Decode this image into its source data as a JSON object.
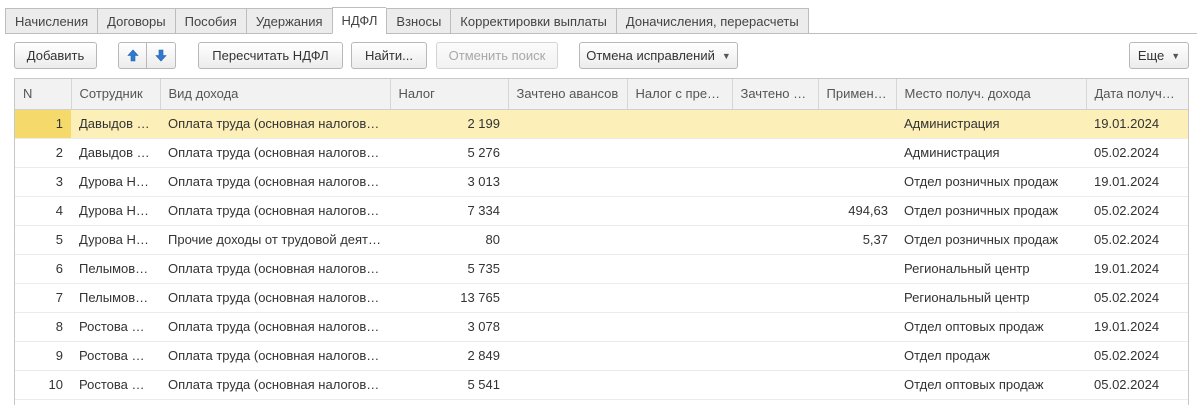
{
  "tabs": [
    {
      "label": "Начисления"
    },
    {
      "label": "Договоры"
    },
    {
      "label": "Пособия"
    },
    {
      "label": "Удержания"
    },
    {
      "label": "НДФЛ"
    },
    {
      "label": "Взносы"
    },
    {
      "label": "Корректировки выплаты"
    },
    {
      "label": "Доначисления, перерасчеты"
    }
  ],
  "active_tab": "НДФЛ",
  "toolbar": {
    "add_label": "Добавить",
    "move_up_icon": "arrow-up-icon",
    "move_down_icon": "arrow-down-icon",
    "recalc_label": "Пересчитать НДФЛ",
    "find_label": "Найти...",
    "cancel_search_label": "Отменить поиск",
    "corrections_label": "Отмена исправлений",
    "more_label": "Еще"
  },
  "colors": {
    "selected_row": "#fcefb8",
    "focused_cell": "#f5d96b",
    "arrow_icon": "#2f7ad1"
  },
  "table": {
    "columns": [
      "N",
      "Сотрудник",
      "Вид дохода",
      "Налог",
      "Зачтено авансов",
      "Налог с пре…",
      "Зачтено …",
      "Примен…",
      "Место получ. дохода",
      "Дата получения"
    ],
    "rows": [
      {
        "n": "1",
        "employee": "Давыдов …",
        "income": "Оплата труда (основная налогов…",
        "tax": "2 199",
        "advances": "",
        "tax_prem": "",
        "credited": "",
        "applied": "",
        "place": "Администрация",
        "date": "19.01.2024",
        "selected": true
      },
      {
        "n": "2",
        "employee": "Давыдов …",
        "income": "Оплата труда (основная налогов…",
        "tax": "5 276",
        "advances": "",
        "tax_prem": "",
        "credited": "",
        "applied": "",
        "place": "Администрация",
        "date": "05.02.2024"
      },
      {
        "n": "3",
        "employee": "Дурова Н…",
        "income": "Оплата труда (основная налогов…",
        "tax": "3 013",
        "advances": "",
        "tax_prem": "",
        "credited": "",
        "applied": "",
        "place": "Отдел розничных продаж",
        "date": "19.01.2024"
      },
      {
        "n": "4",
        "employee": "Дурова Н…",
        "income": "Оплата труда (основная налогов…",
        "tax": "7 334",
        "advances": "",
        "tax_prem": "",
        "credited": "",
        "applied": "494,63",
        "place": "Отдел розничных продаж",
        "date": "05.02.2024"
      },
      {
        "n": "5",
        "employee": "Дурова Н…",
        "income": "Прочие доходы от трудовой деят…",
        "tax": "80",
        "advances": "",
        "tax_prem": "",
        "credited": "",
        "applied": "5,37",
        "place": "Отдел розничных продаж",
        "date": "05.02.2024"
      },
      {
        "n": "6",
        "employee": "Пелымов…",
        "income": "Оплата труда (основная налогов…",
        "tax": "5 735",
        "advances": "",
        "tax_prem": "",
        "credited": "",
        "applied": "",
        "place": "Региональный центр",
        "date": "19.01.2024"
      },
      {
        "n": "7",
        "employee": "Пелымов…",
        "income": "Оплата труда (основная налогов…",
        "tax": "13 765",
        "advances": "",
        "tax_prem": "",
        "credited": "",
        "applied": "",
        "place": "Региональный центр",
        "date": "05.02.2024"
      },
      {
        "n": "8",
        "employee": "Ростова …",
        "income": "Оплата труда (основная налогов…",
        "tax": "3 078",
        "advances": "",
        "tax_prem": "",
        "credited": "",
        "applied": "",
        "place": "Отдел оптовых продаж",
        "date": "19.01.2024"
      },
      {
        "n": "9",
        "employee": "Ростова …",
        "income": "Оплата труда (основная налогов…",
        "tax": "2 849",
        "advances": "",
        "tax_prem": "",
        "credited": "",
        "applied": "",
        "place": "Отдел продаж",
        "date": "05.02.2024"
      },
      {
        "n": "10",
        "employee": "Ростова …",
        "income": "Оплата труда (основная налогов…",
        "tax": "5 541",
        "advances": "",
        "tax_prem": "",
        "credited": "",
        "applied": "",
        "place": "Отдел оптовых продаж",
        "date": "05.02.2024"
      }
    ]
  }
}
